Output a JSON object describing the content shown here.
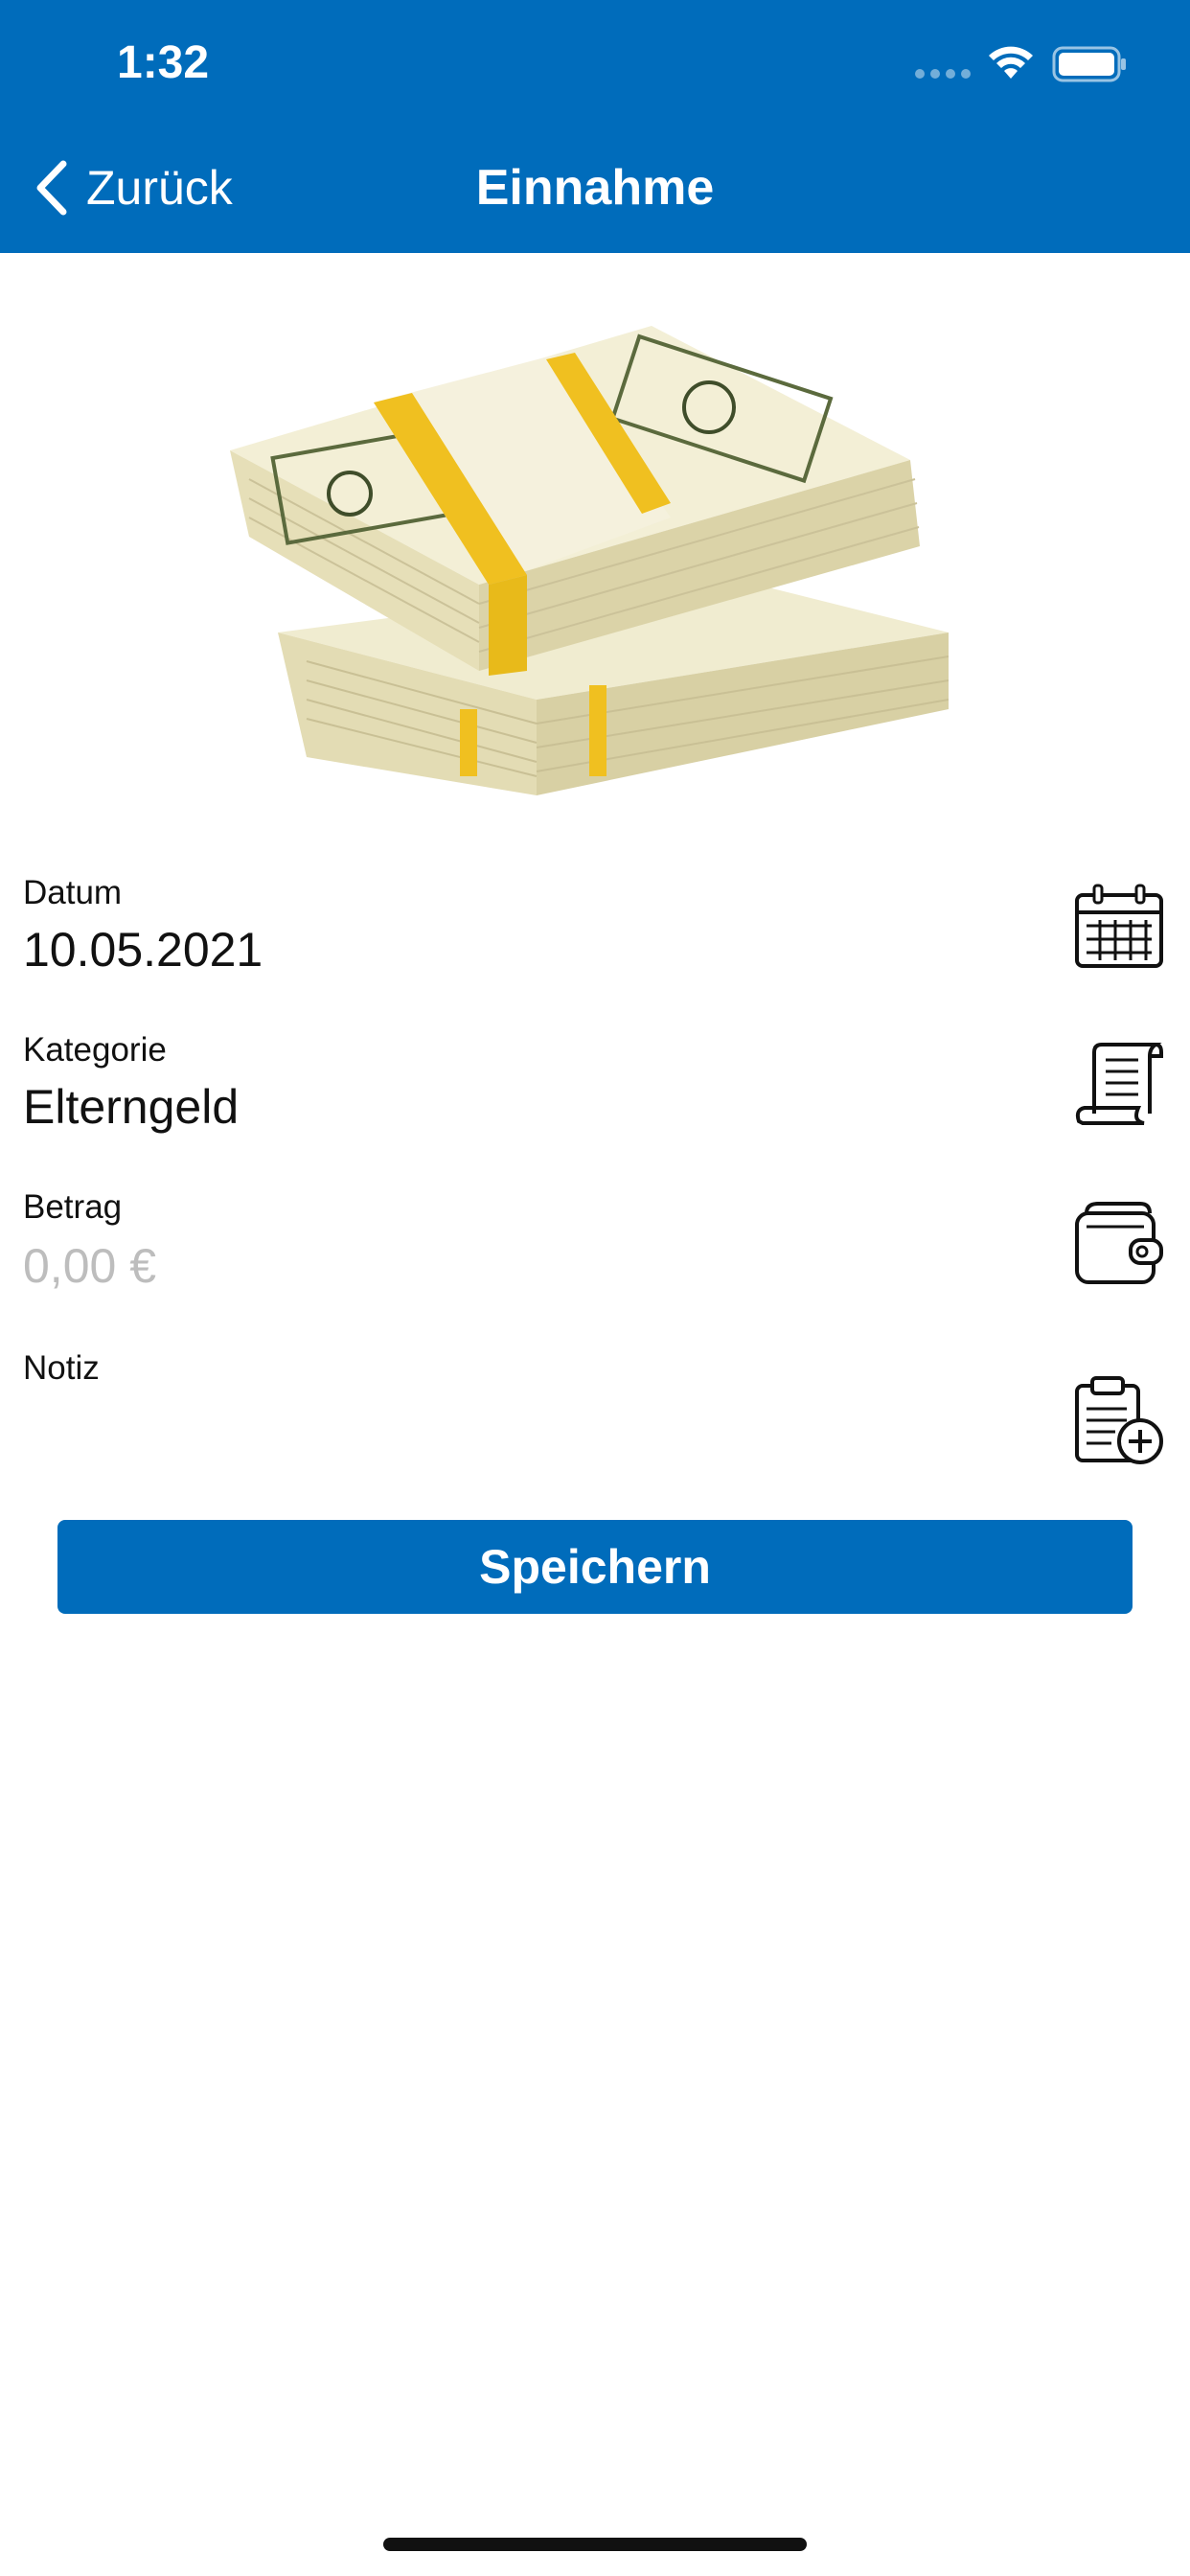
{
  "status_bar": {
    "time": "1:32"
  },
  "nav": {
    "back_label": "Zurück",
    "title": "Einnahme"
  },
  "hero": {
    "image": "money-stack"
  },
  "form": {
    "date": {
      "label": "Datum",
      "value": "10.05.2021",
      "icon": "calendar-icon"
    },
    "category": {
      "label": "Kategorie",
      "value": "Elterngeld",
      "icon": "receipt-icon"
    },
    "amount": {
      "label": "Betrag",
      "placeholder": "0,00 €",
      "icon": "wallet-icon"
    },
    "note": {
      "label": "Notiz",
      "value": "",
      "icon": "clipboard-add-icon"
    }
  },
  "actions": {
    "save_label": "Speichern"
  },
  "colors": {
    "brand": "#006cbb",
    "placeholder": "#bdbdbd"
  }
}
